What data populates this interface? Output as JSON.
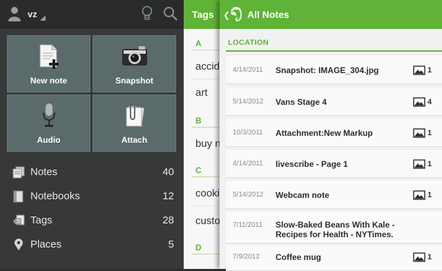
{
  "sidebar": {
    "username": "vz",
    "tiles": [
      {
        "label": "New note",
        "icon": "new-note-icon"
      },
      {
        "label": "Snapshot",
        "icon": "camera-icon"
      },
      {
        "label": "Audio",
        "icon": "microphone-icon"
      },
      {
        "label": "Attach",
        "icon": "paperclip-icon"
      }
    ],
    "items": [
      {
        "label": "Notes",
        "count": "40",
        "icon": "notes-icon"
      },
      {
        "label": "Notebooks",
        "count": "12",
        "icon": "notebook-icon"
      },
      {
        "label": "Tags",
        "count": "28",
        "icon": "tag-icon"
      },
      {
        "label": "Places",
        "count": "5",
        "icon": "location-pin-icon"
      }
    ]
  },
  "tags_panel": {
    "title": "Tags",
    "sections": [
      {
        "letter": "A",
        "items": [
          "accide",
          "art"
        ]
      },
      {
        "letter": "B",
        "items": [
          "buy n"
        ]
      },
      {
        "letter": "C",
        "items": [
          "cookir",
          "custo"
        ]
      },
      {
        "letter": "D",
        "items": []
      }
    ]
  },
  "notes_panel": {
    "title": "All Notes",
    "group_label": "LOCATION",
    "notes": [
      {
        "date": "4/14/2011",
        "title": "Snapshot: IMAGE_304.jpg",
        "count": "1"
      },
      {
        "date": "5/14/2012",
        "title": "Vans Stage 4",
        "count": "4"
      },
      {
        "date": "10/3/2011",
        "title": "Attachment:New Markup",
        "count": "1"
      },
      {
        "date": "4/14/2011",
        "title": "livescribe - Page 1",
        "count": "1"
      },
      {
        "date": "5/14/2012",
        "title": "Webcam note",
        "count": "1"
      },
      {
        "date": "7/11/2011",
        "title": "Slow-Baked Beans With Kale - Recipes for Health - NYTimes.",
        "count": ""
      },
      {
        "date": "7/9/2012",
        "title": "Coffee mug",
        "count": "1"
      }
    ]
  },
  "colors": {
    "accent": "#5fb336",
    "sidebar_bg": "#373939",
    "tile_bg": "#5b6a6a"
  }
}
